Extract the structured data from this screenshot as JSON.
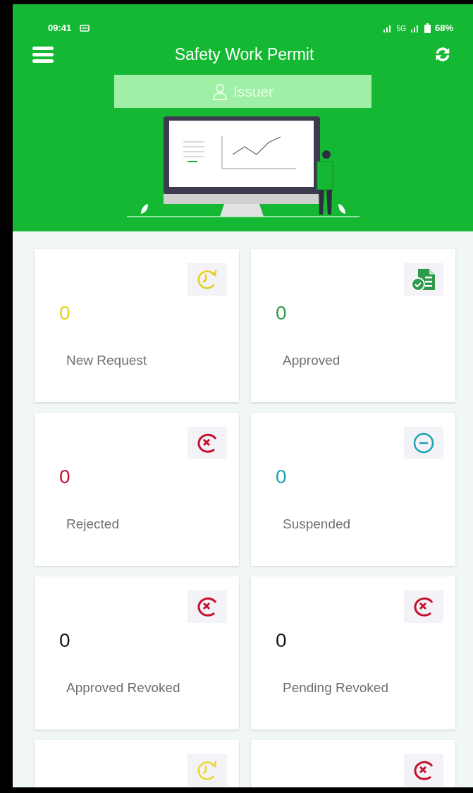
{
  "status_bar": {
    "time": "09:41",
    "network": "5G",
    "battery": "68%"
  },
  "app_bar": {
    "title": "Safety Work Permit",
    "role": "Issuer"
  },
  "cards": [
    {
      "kind": "pending",
      "count": "0",
      "label": "New Request",
      "color": "#e6cf1c"
    },
    {
      "kind": "approved",
      "count": "0",
      "label": "Approved",
      "color": "#2f9a4c"
    },
    {
      "kind": "rejected",
      "count": "0",
      "label": "Rejected",
      "color": "#c8102e"
    },
    {
      "kind": "suspended",
      "count": "0",
      "label": "Suspended",
      "color": "#1aa3b0"
    },
    {
      "kind": "revoked",
      "count": "0",
      "label": "Approved Revoked",
      "color": "#111111"
    },
    {
      "kind": "revoked",
      "count": "0",
      "label": "Pending Revoked",
      "color": "#111111"
    },
    {
      "kind": "pending"
    },
    {
      "kind": "revoked"
    }
  ]
}
